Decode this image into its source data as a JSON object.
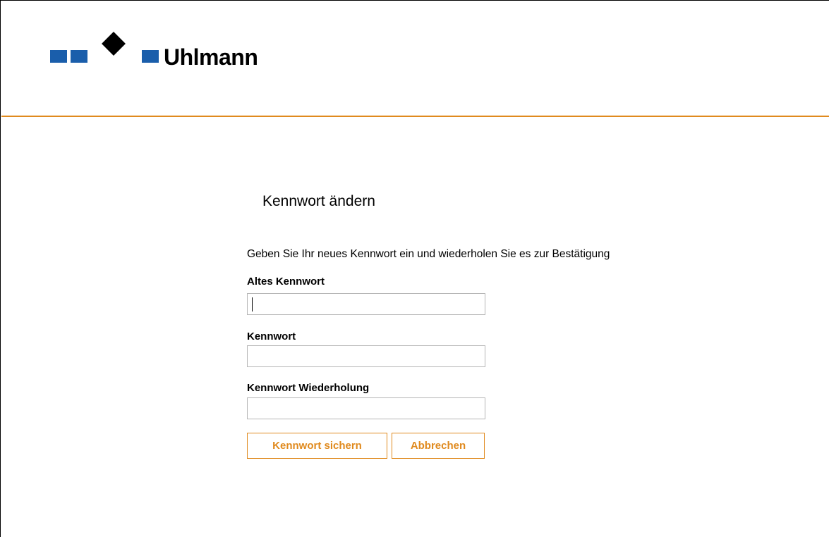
{
  "brand": {
    "name": "Uhlmann",
    "logo_colors": {
      "squares": "#1a5eab",
      "diamond": "#000000"
    }
  },
  "accent_color": "#e08a1e",
  "form": {
    "title": "Kennwort ändern",
    "instruction": "Geben Sie Ihr neues Kennwort ein und wiederholen Sie es zur Bestätigung",
    "fields": {
      "old_password": {
        "label": "Altes Kennwort",
        "value": ""
      },
      "new_password": {
        "label": "Kennwort",
        "value": ""
      },
      "repeat_password": {
        "label": "Kennwort Wiederholung",
        "value": ""
      }
    },
    "buttons": {
      "save": "Kennwort sichern",
      "cancel": "Abbrechen"
    }
  }
}
